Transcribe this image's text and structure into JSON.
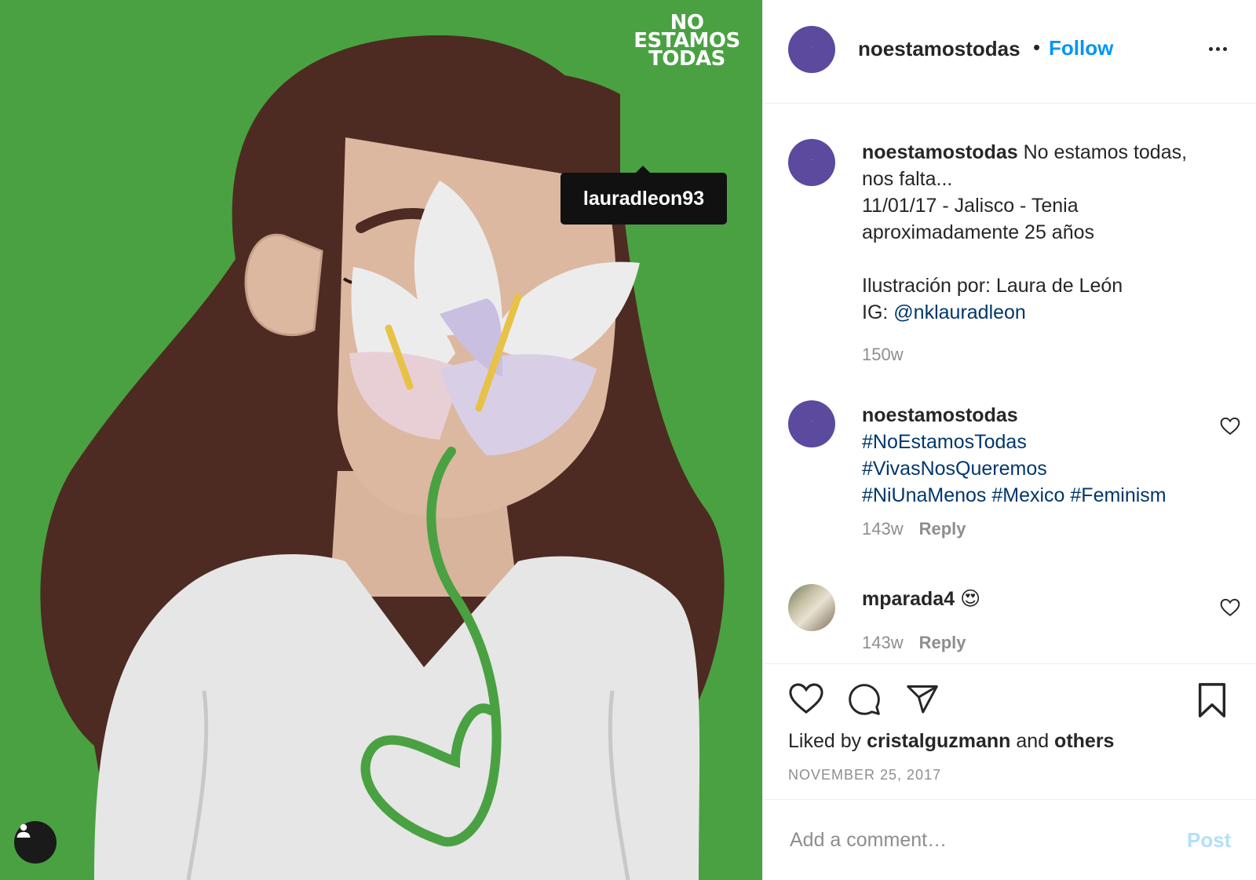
{
  "image": {
    "logo_lines": [
      "NO",
      "ESTAMOS",
      "TODAS"
    ],
    "tag": "lauradleon93"
  },
  "header": {
    "username": "noestamostodas",
    "dot": "•",
    "follow_label": "Follow"
  },
  "caption": {
    "username": "noestamostodas",
    "lines": [
      " No estamos todas,",
      "nos falta...",
      "11/01/17 - Jalisco - Tenia",
      "aproximadamente 25 años"
    ],
    "illustrator_line": "Ilustración por: Laura de León",
    "ig_prefix": "IG: ",
    "ig_handle": "@nklauradleon",
    "time": "150w"
  },
  "comments": [
    {
      "username": "noestamostodas",
      "tags": [
        "#NoEstamosTodas",
        "#VivasNosQueremos",
        "#NiUnaMenos #Mexico #Feminism"
      ],
      "time": "143w",
      "reply_label": "Reply"
    },
    {
      "username": "mparada4",
      "emoji": "😍",
      "time": "143w",
      "reply_label": "Reply"
    }
  ],
  "actions": {
    "liked_by_prefix": "Liked by ",
    "liked_by_user": "cristalguzmann",
    "and_label": " and ",
    "others_label": "others",
    "date": "NOVEMBER 25, 2017"
  },
  "comment_box": {
    "placeholder": "Add a comment…",
    "post_label": "Post"
  },
  "colors": {
    "follow_blue": "#0095f6",
    "link_blue": "#00376b",
    "image_green": "#4aa142",
    "avatar_purple": "#5b4a9e"
  }
}
